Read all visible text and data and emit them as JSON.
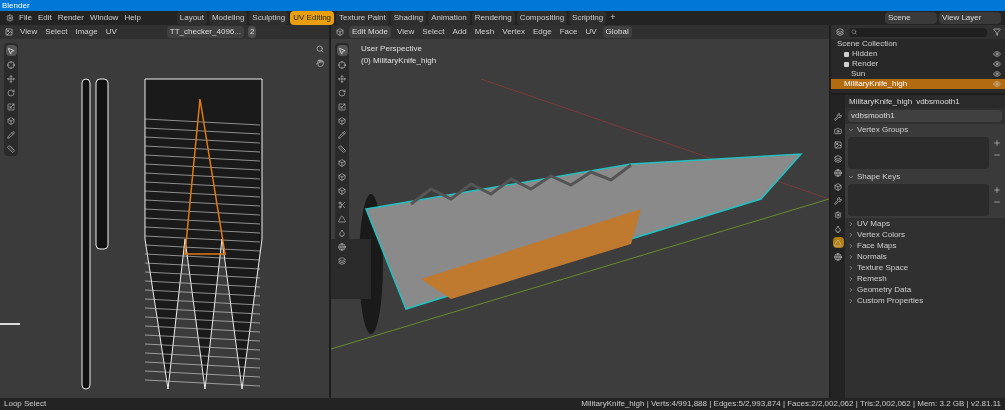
{
  "window": {
    "title": "Blender"
  },
  "menu": [
    "File",
    "Edit",
    "Render",
    "Window",
    "Help"
  ],
  "workspaces": [
    {
      "label": "Layout",
      "selected": false
    },
    {
      "label": "Modeling",
      "selected": false
    },
    {
      "label": "Sculpting",
      "selected": false
    },
    {
      "label": "UV Editing",
      "selected": true
    },
    {
      "label": "Texture Paint",
      "selected": false
    },
    {
      "label": "Shading",
      "selected": false
    },
    {
      "label": "Animation",
      "selected": false
    },
    {
      "label": "Rendering",
      "selected": false
    },
    {
      "label": "Compositing",
      "selected": false
    },
    {
      "label": "Scripting",
      "selected": false
    }
  ],
  "add_workspace": "+",
  "scene": "Scene",
  "view_layer": "View Layer",
  "uv_editor": {
    "menu": [
      "View",
      "Select",
      "Image",
      "UV"
    ],
    "image_name": "TT_checker_4096...",
    "users": "2"
  },
  "viewport": {
    "mode": "Edit Mode",
    "menu": [
      "View",
      "Select",
      "Add",
      "Mesh",
      "Vertex",
      "Edge",
      "Face",
      "UV"
    ],
    "orientation": "Global",
    "info": [
      "User Perspective",
      "(0) MilitaryKnife_high"
    ]
  },
  "outliner": {
    "items": [
      {
        "label": "Scene Collection",
        "selected": false,
        "children": [
          {
            "label": "Hidden",
            "selected": false,
            "checked": true
          },
          {
            "label": "Render",
            "selected": false,
            "checked": true,
            "children": [
              {
                "label": "Sun",
                "selected": false
              }
            ]
          },
          {
            "label": "MilitaryKnife_high",
            "selected": true
          }
        ]
      }
    ]
  },
  "properties": {
    "object": "MilitaryKnife_high",
    "data": "vdbsmooth1",
    "data_field": "vdbsmooth1",
    "panels": [
      {
        "label": "Vertex Groups",
        "expanded": true
      },
      {
        "label": "Shape Keys",
        "expanded": true
      },
      {
        "label": "UV Maps",
        "expanded": false
      },
      {
        "label": "Vertex Colors",
        "expanded": false
      },
      {
        "label": "Face Maps",
        "expanded": false
      },
      {
        "label": "Normals",
        "expanded": false
      },
      {
        "label": "Texture Space",
        "expanded": false
      },
      {
        "label": "Remesh",
        "expanded": false
      },
      {
        "label": "Geometry Data",
        "expanded": false
      },
      {
        "label": "Custom Properties",
        "expanded": false
      }
    ]
  },
  "status_bar": {
    "action": "Loop Select",
    "stats": "MilitaryKnife_high | Verts:4/991,888 | Edges:5/2,993,874 | Faces:2/2,002,062 | Tris:2,002,062 | Mem: 3.2 GB | v2.81.11"
  }
}
